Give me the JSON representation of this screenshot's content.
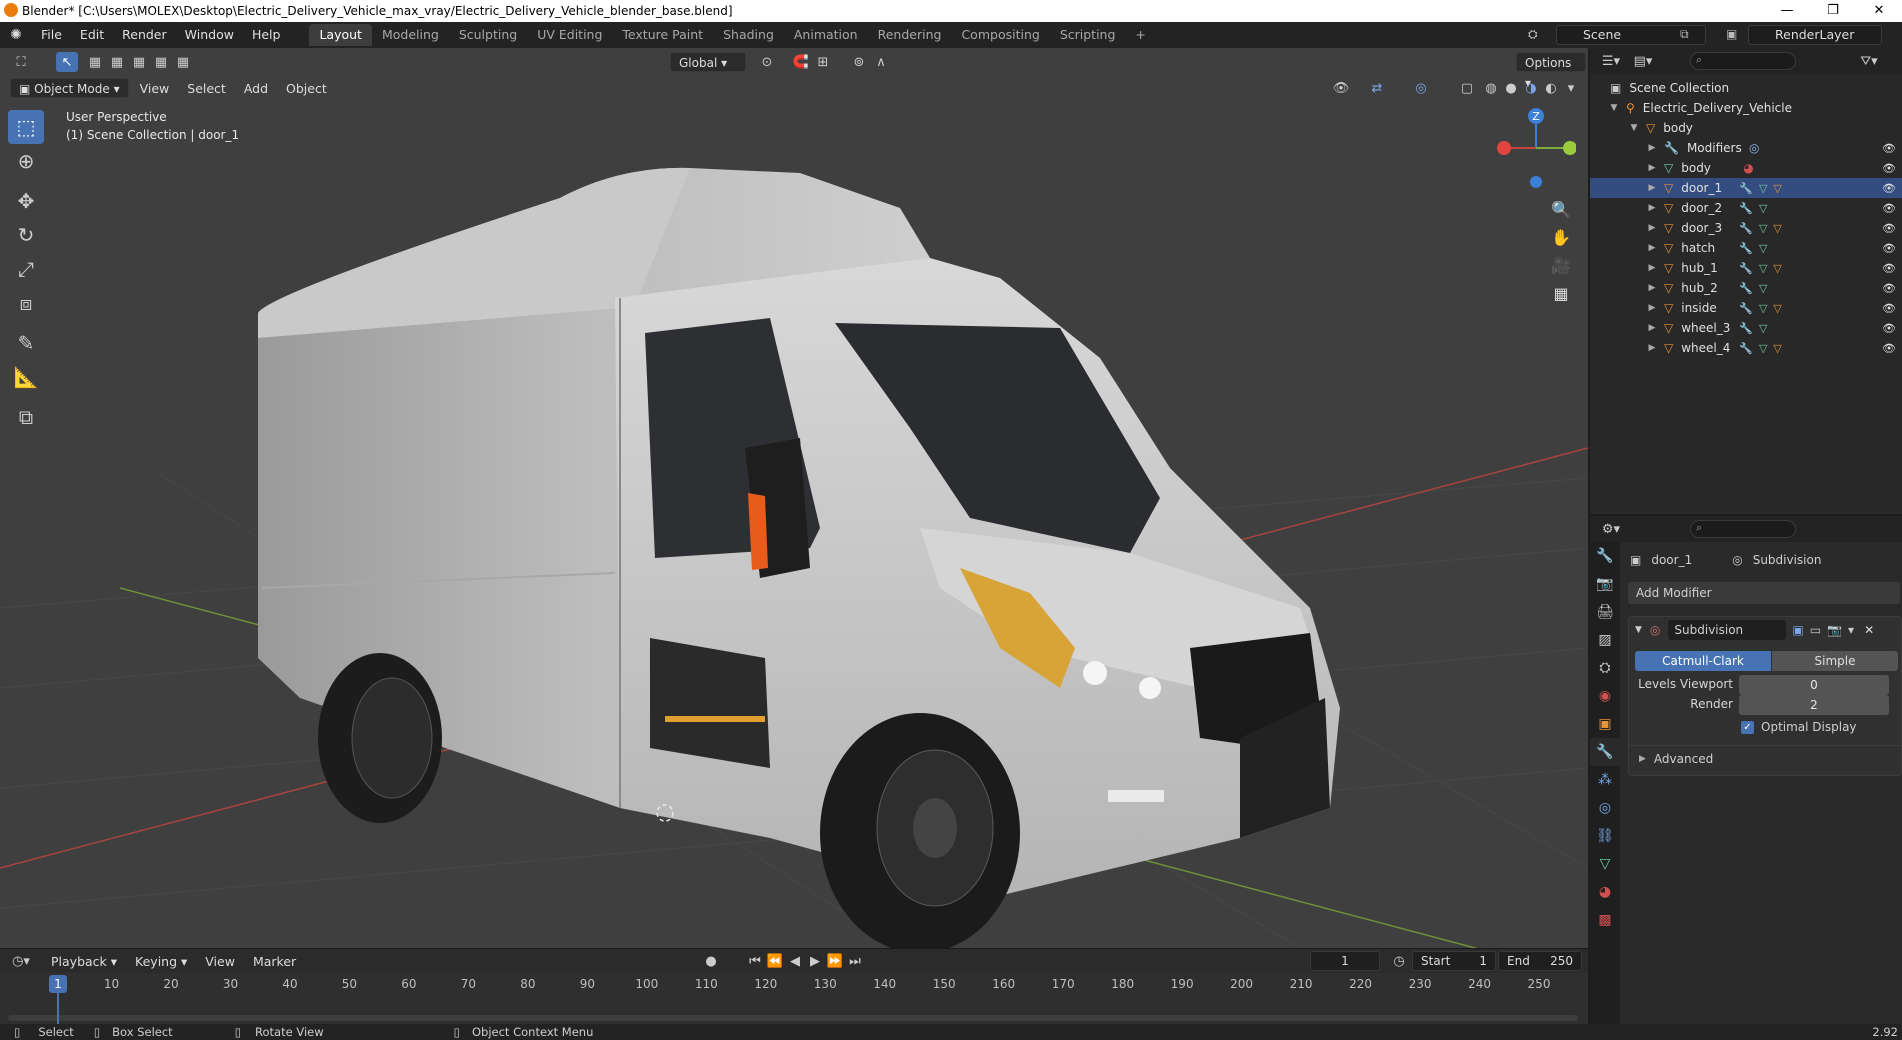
{
  "window": {
    "title": "Blender* [C:\\Users\\MOLEX\\Desktop\\Electric_Delivery_Vehicle_max_vray/Electric_Delivery_Vehicle_blender_base.blend]",
    "minimize": "—",
    "restore": "❐",
    "close": "✕"
  },
  "menu": [
    "File",
    "Edit",
    "Render",
    "Window",
    "Help"
  ],
  "workspaces": [
    "Layout",
    "Modeling",
    "Sculpting",
    "UV Editing",
    "Texture Paint",
    "Shading",
    "Animation",
    "Rendering",
    "Compositing",
    "Scripting"
  ],
  "active_workspace": "Layout",
  "add_workspace": "+",
  "scene": "Scene",
  "render_layer": "RenderLayer",
  "viewport": {
    "transform_orientation": "Global",
    "options_label": "Options",
    "mode": "Object Mode",
    "header_menus": [
      "View",
      "Select",
      "Add",
      "Object"
    ],
    "perspective_label": "User Perspective",
    "collection_label": "(1) Scene Collection | door_1",
    "gizmo_axis": "Z",
    "icons": [
      "select-box-icon",
      "cursor-icon",
      "move-icon",
      "rotate-icon",
      "scale-icon",
      "transform-icon",
      "annotate-icon",
      "measure-icon",
      "add-cube-icon"
    ]
  },
  "outliner": {
    "root": "Scene Collection",
    "collection": "Electric_Delivery_Vehicle",
    "parent": "body",
    "items": [
      {
        "label": "Modifiers",
        "type": "modifier"
      },
      {
        "label": "body",
        "type": "mesh"
      },
      {
        "label": "door_1",
        "type": "object",
        "selected": true
      },
      {
        "label": "door_2",
        "type": "object"
      },
      {
        "label": "door_3",
        "type": "object"
      },
      {
        "label": "hatch",
        "type": "object"
      },
      {
        "label": "hub_1",
        "type": "object"
      },
      {
        "label": "hub_2",
        "type": "object"
      },
      {
        "label": "inside",
        "type": "object"
      },
      {
        "label": "wheel_3",
        "type": "object"
      },
      {
        "label": "wheel_4",
        "type": "object"
      }
    ]
  },
  "properties": {
    "object_name": "door_1",
    "modifier_tab_label": "Subdivision",
    "add_modifier": "Add Modifier",
    "modifier_name": "Subdivision",
    "subdiv_types": [
      "Catmull-Clark",
      "Simple"
    ],
    "active_subdiv_type": "Catmull-Clark",
    "levels_viewport_label": "Levels Viewport",
    "levels_viewport": "0",
    "render_label": "Render",
    "render_levels": "2",
    "optimal_display_label": "Optimal Display",
    "optimal_display": true,
    "advanced_label": "Advanced"
  },
  "timeline": {
    "menus": [
      "Playback",
      "Keying",
      "View",
      "Marker"
    ],
    "current_frame": "1",
    "start_label": "Start",
    "start": "1",
    "end_label": "End",
    "end": "250",
    "ticks": [
      "1",
      "10",
      "20",
      "30",
      "40",
      "50",
      "60",
      "70",
      "80",
      "90",
      "100",
      "110",
      "120",
      "130",
      "140",
      "150",
      "160",
      "170",
      "180",
      "190",
      "200",
      "210",
      "220",
      "230",
      "240",
      "250"
    ]
  },
  "statusbar": {
    "select": "Select",
    "box_select": "Box Select",
    "rotate_view": "Rotate View",
    "context_menu": "Object Context Menu",
    "version": "2.92"
  },
  "colors": {
    "accent": "#4772b3",
    "viewport_bg": "#3f3f3f",
    "panel_bg": "#2a2a2a",
    "x_axis": "#c8453f",
    "y_axis": "#7fab3b",
    "z_axis": "#3b7fd6"
  }
}
